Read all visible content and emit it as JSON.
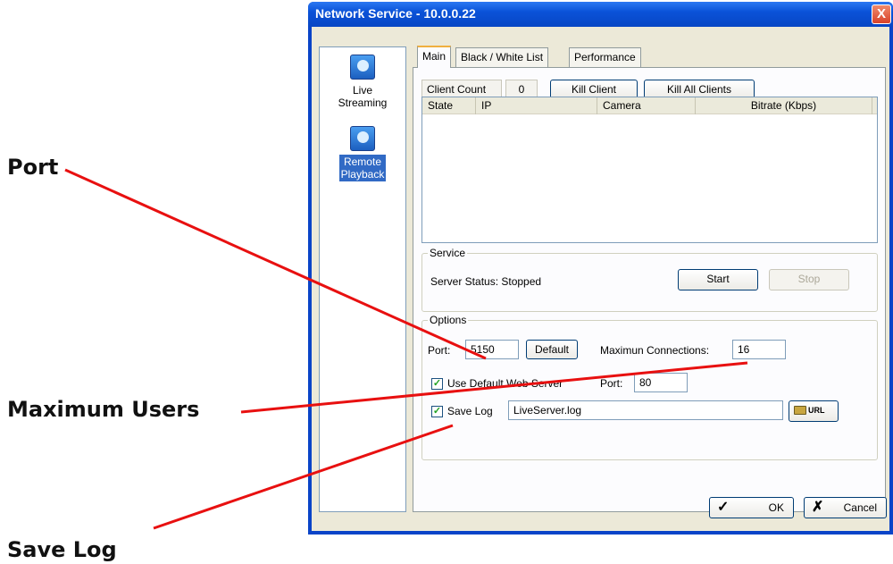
{
  "window": {
    "title": "Network Service - 10.0.0.22",
    "close_symbol": "X"
  },
  "sidebar": {
    "items": [
      {
        "label_line1": "Live",
        "label_line2": "Streaming",
        "icon": "live-streaming-icon",
        "selected": false
      },
      {
        "label_line1": "Remote",
        "label_line2": "Playback",
        "icon": "remote-playback-icon",
        "selected": true
      }
    ]
  },
  "tabs": [
    {
      "label": "Main",
      "active": true
    },
    {
      "label": "Black / White List",
      "active": false
    },
    {
      "label": "Performance",
      "active": false
    }
  ],
  "main": {
    "client_count_label": "Client Count",
    "client_count_value": "0",
    "kill_client_label": "Kill Client",
    "kill_all_label": "Kill All Clients",
    "columns": [
      "State",
      "IP",
      "Camera",
      "Bitrate (Kbps)"
    ],
    "service": {
      "group_title": "Service",
      "status_text": "Server Status: Stopped",
      "start_label": "Start",
      "stop_label": "Stop"
    },
    "options": {
      "group_title": "Options",
      "port_label": "Port:",
      "port_value": "5150",
      "default_label": "Default",
      "max_conn_label": "Maximun Connections:",
      "max_conn_value": "16",
      "use_web_label": "Use Default Web Server",
      "use_web_checked": true,
      "web_port_label": "Port:",
      "web_port_value": "80",
      "save_log_label": "Save Log",
      "save_log_checked": true,
      "log_file_value": "LiveServer.log",
      "url_label": "URL"
    }
  },
  "footer": {
    "ok_label": "OK",
    "cancel_label": "Cancel"
  },
  "callouts": {
    "port": "Port",
    "max_users": "Maximum Users",
    "save_log": "Save Log",
    "line_color": "#e81010"
  },
  "colors": {
    "titlebar": "#0a52d8",
    "dialog_bg": "#ece9d8",
    "selection": "#316ac5"
  }
}
